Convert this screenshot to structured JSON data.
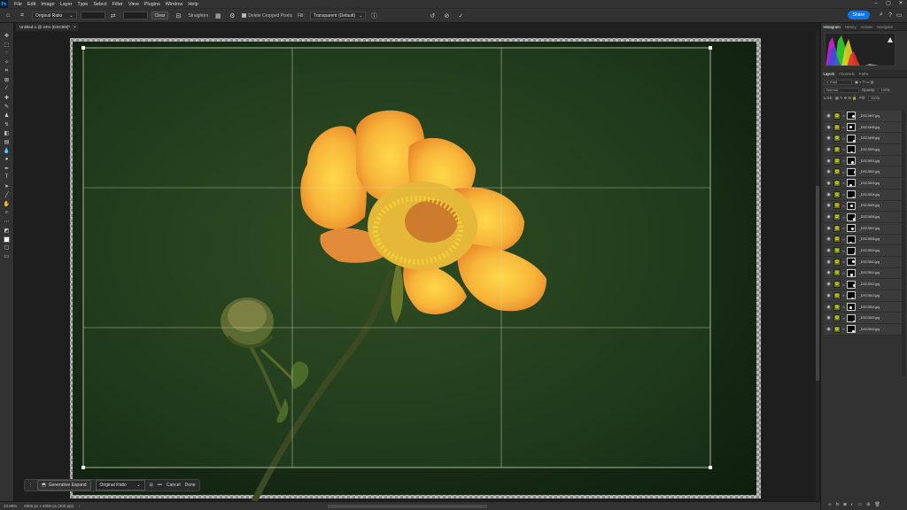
{
  "menubar": {
    "logo": "Ps",
    "items": [
      "File",
      "Edit",
      "Image",
      "Layer",
      "Type",
      "Select",
      "Filter",
      "View",
      "Plugins",
      "Window",
      "Help"
    ],
    "window_controls": [
      "–",
      "▢",
      "✕"
    ]
  },
  "options_bar": {
    "ratio": "Original Ratio",
    "clear_label": "Clear",
    "straighten_label": "Straighten",
    "delete_cropped_label": "Delete Cropped Pixels",
    "fill_label": "Fill:",
    "fill_value": "Transparent (Default)",
    "share_label": "Share"
  },
  "document": {
    "tab_title": "Untitled-1 @ 24% (DSC8/8)*"
  },
  "context_bar": {
    "generative_expand_label": "Generative Expand",
    "ratio_value": "Original Ratio",
    "more_label": "•••",
    "cancel_label": "Cancel",
    "done_label": "Done"
  },
  "status": {
    "zoom": "23.89%",
    "doc_size": "6000 px x 4000 px (300 ppi)"
  },
  "panels": {
    "top_tabs": [
      "Histogram",
      "History",
      "Actions",
      "Navigator"
    ],
    "layer_tabs": [
      "Layers",
      "Channels",
      "Paths"
    ],
    "kind_label": "Kind",
    "blend_mode": "Normal",
    "opacity_label": "Opacity:",
    "opacity_value": "100%",
    "lock_label": "Lock:",
    "fill_label": "Fill:",
    "fill_value": "100%"
  },
  "layers": [
    "_DSC3497.jpg",
    "_DSC3498.jpg",
    "_DSC3499.jpg",
    "_DSC3500.jpg",
    "_DSC3501.jpg",
    "_DSC3502.jpg",
    "_DSC3503.jpg",
    "_DSC3504.jpg",
    "_DSC3505.jpg",
    "_DSC3506.jpg",
    "_DSC3507.jpg",
    "_DSC3508.jpg",
    "_DSC3509.jpg",
    "_DSC3510.jpg",
    "_DSC3511.jpg",
    "_DSC3512.jpg",
    "_DSC3513.jpg",
    "_DSC3514.jpg",
    "_DSC3515.jpg",
    "_DSC3516.jpg"
  ],
  "colors": {
    "background_green": "#1f3a1c",
    "petal": "#f5a623",
    "accent": "#1473e6"
  }
}
